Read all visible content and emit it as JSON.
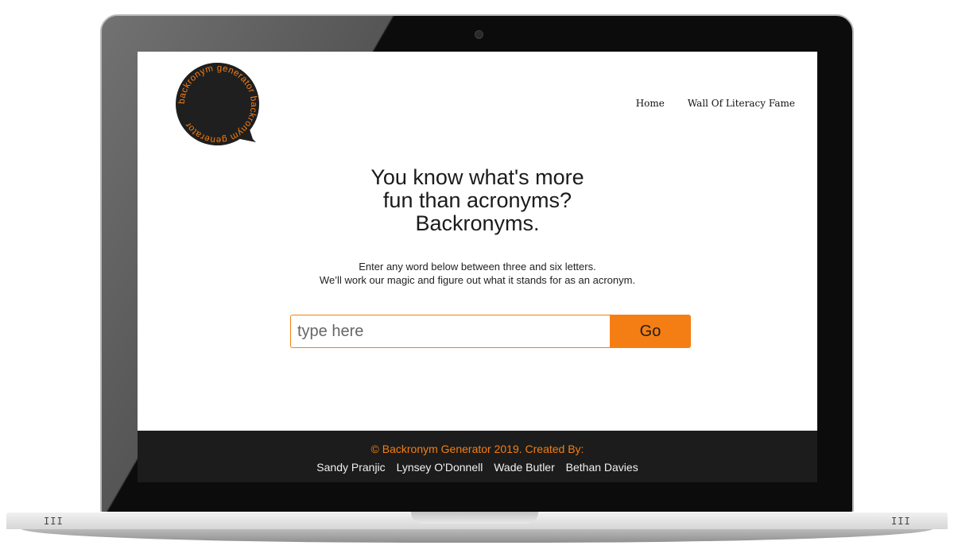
{
  "logo": {
    "ring_text": "backronym generator backronym generator",
    "colors": {
      "fill": "#1f1f1f",
      "text": "#f47e13"
    }
  },
  "nav": {
    "home": "Home",
    "wall": "Wall Of Literacy Fame"
  },
  "hero": {
    "line1": "You know what's more",
    "line2": "fun than acronyms?",
    "line3": "Backronyms.",
    "sub1": "Enter any word below between three and six letters.",
    "sub2": "We’ll work our magic and figure out what it stands for as an acronym."
  },
  "search": {
    "placeholder": "type here",
    "value": "",
    "button": "Go"
  },
  "footer": {
    "copyright": "© Backronym Generator 2019. Created By:",
    "authors": [
      "Sandy Pranjic",
      "Lynsey O'Donnell",
      "Wade Butler",
      "Bethan Davies"
    ]
  },
  "device": {
    "vent_left": "III",
    "vent_right": "III"
  },
  "colors": {
    "accent": "#f47e13",
    "footer_bg": "#1c1c1c"
  }
}
